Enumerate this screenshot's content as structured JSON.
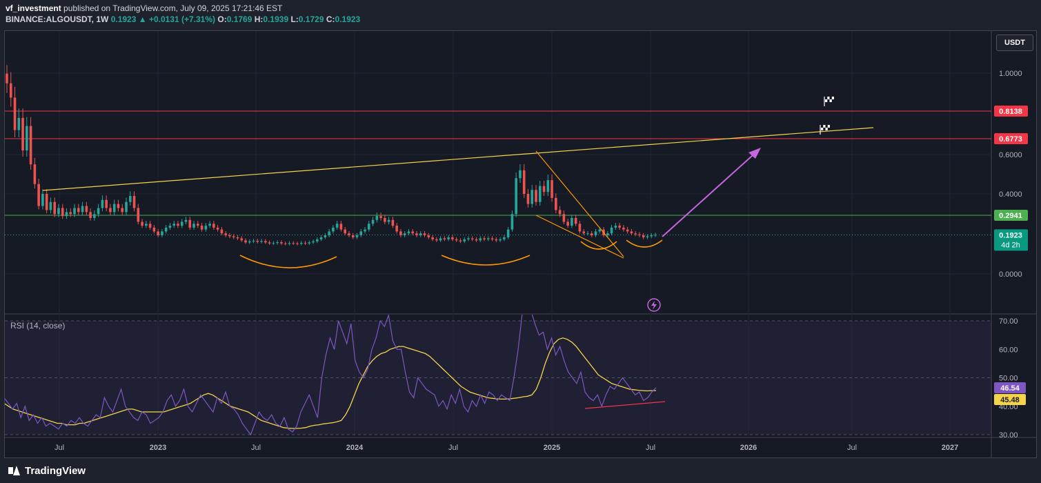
{
  "header": {
    "author": "vf_investment",
    "published": "published on TradingView.com, July 09, 2025 17:21:46 EST",
    "symbol": "BINANCE:ALGOUSDT, 1W",
    "last": "0.1923",
    "change": "▲ +0.0131 (+7.31%)",
    "o_label": "O:",
    "o": "0.1769",
    "h_label": "H:",
    "h": "0.1939",
    "l_label": "L:",
    "l": "0.1729",
    "c_label": "C:",
    "c": "0.1923"
  },
  "currency_button": "USDT",
  "footer": {
    "brand": "TradingView"
  },
  "rsi_label": "RSI (14, close)",
  "colors": {
    "bull": "#26a69a",
    "bear": "#ef5350",
    "trendline": "#f5d547",
    "resistance": "#f23645",
    "support": "#4caf50",
    "arc": "#ff9800",
    "arrow": "#c766e0",
    "rsi": "#7e57c2",
    "rsi_ma": "#f5d547"
  },
  "chart_data": [
    {
      "type": "candlestick",
      "title": "BINANCE:ALGOUSDT, 1W",
      "x_ticks": [
        "Jul",
        "2023",
        "Jul",
        "2024",
        "Jul",
        "2025",
        "Jul",
        "2026",
        "Jul",
        "2027"
      ],
      "y_ticks": [
        "1.0000",
        "0.6000",
        "0.4000",
        "0.0000"
      ],
      "y_scale": "log",
      "price_labels": [
        {
          "value": "0.8138",
          "kind": "resistance"
        },
        {
          "value": "0.6773",
          "kind": "resistance"
        },
        {
          "value": "0.2941",
          "kind": "support"
        },
        {
          "value": "0.1923",
          "kind": "last",
          "sub": "4d 2h"
        }
      ],
      "closes": [
        0.95,
        0.88,
        0.72,
        0.78,
        0.62,
        0.74,
        0.55,
        0.45,
        0.34,
        0.4,
        0.32,
        0.36,
        0.3,
        0.33,
        0.29,
        0.31,
        0.3,
        0.33,
        0.31,
        0.34,
        0.31,
        0.28,
        0.3,
        0.33,
        0.37,
        0.33,
        0.31,
        0.35,
        0.33,
        0.31,
        0.36,
        0.39,
        0.33,
        0.26,
        0.24,
        0.25,
        0.23,
        0.21,
        0.19,
        0.21,
        0.23,
        0.24,
        0.25,
        0.24,
        0.26,
        0.27,
        0.23,
        0.25,
        0.24,
        0.22,
        0.24,
        0.25,
        0.23,
        0.22,
        0.2,
        0.19,
        0.185,
        0.18,
        0.175,
        0.165,
        0.155,
        0.16,
        0.163,
        0.158,
        0.162,
        0.155,
        0.15,
        0.152,
        0.156,
        0.15,
        0.148,
        0.152,
        0.15,
        0.148,
        0.153,
        0.15,
        0.155,
        0.16,
        0.17,
        0.18,
        0.19,
        0.21,
        0.23,
        0.25,
        0.22,
        0.2,
        0.19,
        0.18,
        0.19,
        0.21,
        0.22,
        0.25,
        0.27,
        0.29,
        0.28,
        0.26,
        0.27,
        0.24,
        0.21,
        0.19,
        0.2,
        0.21,
        0.2,
        0.19,
        0.2,
        0.19,
        0.18,
        0.17,
        0.165,
        0.175,
        0.17,
        0.18,
        0.17,
        0.165,
        0.16,
        0.17,
        0.175,
        0.17,
        0.165,
        0.175,
        0.17,
        0.175,
        0.17,
        0.165,
        0.17,
        0.18,
        0.22,
        0.3,
        0.48,
        0.52,
        0.4,
        0.35,
        0.42,
        0.36,
        0.44,
        0.41,
        0.47,
        0.38,
        0.32,
        0.3,
        0.26,
        0.24,
        0.28,
        0.25,
        0.21,
        0.2,
        0.2,
        0.19,
        0.21,
        0.22,
        0.19,
        0.2,
        0.23,
        0.24,
        0.23,
        0.22,
        0.21,
        0.2,
        0.195,
        0.19,
        0.18,
        0.185,
        0.19,
        0.1923
      ],
      "annotations": [
        {
          "kind": "trendline",
          "from": [
            "2022-05",
            0.42
          ],
          "to": [
            "2026-07",
            0.72
          ]
        },
        {
          "kind": "trendline",
          "from": [
            "2024-12",
            0.6
          ],
          "to": [
            "2025-06",
            0.17
          ]
        },
        {
          "kind": "trendline",
          "from": [
            "2024-12",
            0.28
          ],
          "to": [
            "2025-05",
            0.15
          ]
        },
        {
          "kind": "arrow",
          "from": [
            "2025-07",
            0.2
          ],
          "to": [
            "2026-01",
            0.63
          ]
        }
      ]
    },
    {
      "type": "line",
      "title": "RSI (14, close)",
      "y_ticks": [
        "70.00",
        "60.00",
        "50.00",
        "40.00",
        "30.00"
      ],
      "ylim": [
        30,
        70
      ],
      "value_labels": [
        {
          "value": "46.54",
          "series": "rsi"
        },
        {
          "value": "45.48",
          "series": "ma"
        }
      ],
      "rsi": [
        43,
        41,
        39,
        41,
        36,
        40,
        35,
        37,
        34,
        36,
        33,
        34,
        33,
        32,
        34,
        33,
        35,
        34,
        36,
        34,
        33,
        35,
        37,
        36,
        43,
        40,
        38,
        42,
        46,
        40,
        38,
        36,
        35,
        38,
        37,
        34,
        35,
        36,
        38,
        42,
        44,
        40,
        42,
        46,
        40,
        38,
        41,
        44,
        42,
        40,
        38,
        43,
        41,
        45,
        40,
        39,
        37,
        34,
        32,
        30,
        34,
        38,
        36,
        35,
        37,
        34,
        33,
        36,
        32,
        31,
        33,
        38,
        41,
        44,
        40,
        36,
        50,
        58,
        64,
        60,
        70,
        66,
        62,
        69,
        56,
        52,
        50,
        53,
        60,
        64,
        70,
        68,
        72,
        63,
        60,
        60,
        52,
        45,
        43,
        50,
        48,
        46,
        45,
        44,
        40,
        42,
        39,
        44,
        41,
        46,
        40,
        38,
        42,
        40,
        44,
        41,
        45,
        44,
        42,
        44,
        43,
        42,
        50,
        60,
        73,
        82,
        76,
        69,
        65,
        66,
        60,
        64,
        58,
        61,
        56,
        52,
        50,
        48,
        52,
        45,
        43,
        42,
        44,
        40,
        44,
        47,
        46,
        48,
        50,
        48,
        46,
        44,
        45,
        42,
        43,
        45,
        46.54
      ],
      "ma": [
        41,
        40,
        39,
        38.5,
        38,
        37.5,
        37,
        36.5,
        36,
        35.5,
        35,
        34.5,
        34,
        34,
        33.5,
        33.5,
        33.5,
        34,
        34,
        34.5,
        35,
        35.5,
        36,
        36.5,
        37,
        37.5,
        38,
        38.5,
        39,
        39,
        38.5,
        38,
        38,
        38,
        38,
        38,
        38,
        38.5,
        39,
        39.5,
        40,
        40.5,
        41,
        42,
        43,
        44,
        44.5,
        44,
        43,
        42,
        41,
        40,
        39.5,
        39,
        38.5,
        38,
        37,
        36,
        35,
        34.5,
        34,
        33.5,
        33,
        32.5,
        32.3,
        32.2,
        32.2,
        32.3,
        32.5,
        33,
        33.3,
        33.5,
        33.8,
        34,
        34.2,
        34.5,
        35,
        37,
        40,
        44,
        48,
        51,
        54,
        56,
        57.5,
        58.5,
        59,
        60,
        60.5,
        61,
        61,
        60.5,
        60,
        59.5,
        59,
        58.5,
        57.5,
        56,
        54.5,
        53,
        51.5,
        50,
        48.5,
        47,
        46,
        45,
        44.5,
        44,
        43.5,
        43,
        42.8,
        42.6,
        42.5,
        42.5,
        42.6,
        42.8,
        43,
        43.3,
        43.5,
        44,
        46,
        50,
        55,
        59,
        62,
        63.5,
        64,
        63.5,
        62.5,
        61,
        59,
        57,
        55,
        53,
        51,
        50,
        49,
        48,
        47.5,
        47,
        46.5,
        46,
        45.8,
        45.6,
        45.5,
        45.4,
        45.5,
        45.48
      ]
    }
  ]
}
